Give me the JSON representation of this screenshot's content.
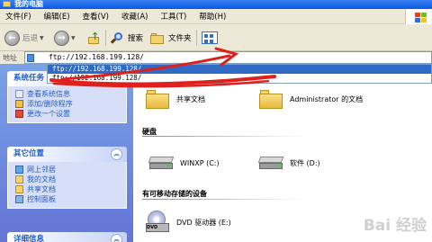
{
  "window": {
    "title": "我的电脑"
  },
  "menu": [
    "文件(F)",
    "编辑(E)",
    "查看(V)",
    "收藏(A)",
    "工具(T)",
    "帮助(H)"
  ],
  "toolbar": {
    "back_label": "后退",
    "search_label": "搜索",
    "folders_label": "文件夹"
  },
  "address": {
    "label": "地址",
    "value": "ftp://192.168.199.128/",
    "suggestions": [
      "ftp://192.168.199.128/",
      "ftp://192.168.199.128/"
    ]
  },
  "left_panel": {
    "system_tasks": {
      "title": "系统任务",
      "items": [
        {
          "label": "查看系统信息",
          "icon": "info-icon"
        },
        {
          "label": "添加/删除程序",
          "icon": "add-remove-icon"
        },
        {
          "label": "更改一个设置",
          "icon": "settings-icon"
        }
      ]
    },
    "other_places": {
      "title": "其它位置",
      "items": [
        {
          "label": "网上邻居",
          "icon": "network-icon"
        },
        {
          "label": "我的文档",
          "icon": "documents-icon"
        },
        {
          "label": "共享文档",
          "icon": "shared-docs-icon"
        },
        {
          "label": "控制面板",
          "icon": "control-panel-icon"
        }
      ]
    },
    "details": {
      "title": "详细信息"
    }
  },
  "main": {
    "folders": [
      {
        "label": "共享文档"
      },
      {
        "label": "Administrator 的文档"
      }
    ],
    "hard_disks": {
      "title": "硬盘",
      "items": [
        {
          "label": "WINXP (C:)"
        },
        {
          "label": "软件 (D:)"
        }
      ]
    },
    "removable": {
      "title": "有可移动存储的设备",
      "items": [
        {
          "label": "DVD 驱动器 (E:)",
          "badge": "DVD"
        }
      ]
    }
  },
  "watermark": "Bai 经验"
}
